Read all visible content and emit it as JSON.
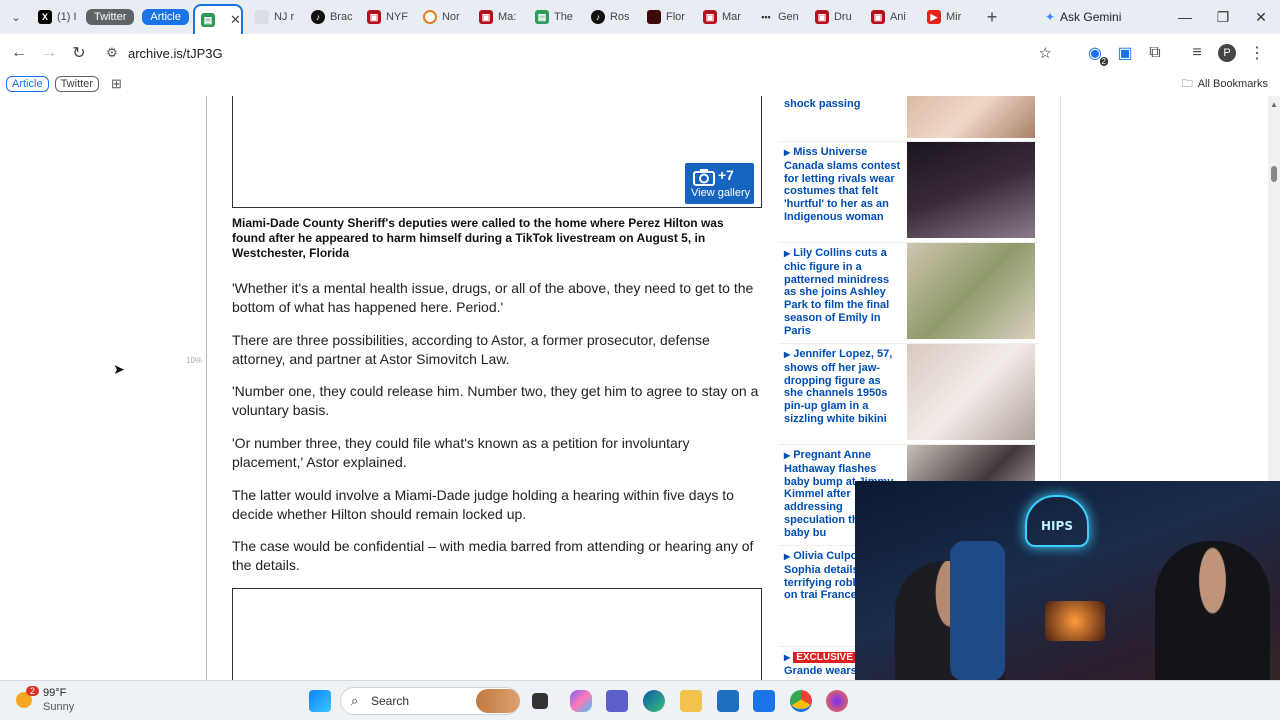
{
  "tabs": {
    "twitter_tab": "(1) I",
    "group_twitter": "Twitter",
    "group_article": "Article",
    "others": [
      "NJ r",
      "Brac",
      "NYF",
      "Nor",
      "Ma:",
      "The",
      "Ros",
      "Flor",
      "Mar",
      "Gen",
      "Dru",
      "Ani",
      "Mir"
    ],
    "ask_gemini": "Ask Gemini"
  },
  "address": {
    "url": "archive.is/tJP3G"
  },
  "bookmarks": {
    "article": "Article",
    "twitter": "Twitter",
    "all": "All Bookmarks"
  },
  "extensions": {
    "badge": "2",
    "profile": "P"
  },
  "page": {
    "scroll_pct": "10%",
    "gallery": {
      "count": "+7",
      "label": "View gallery"
    },
    "caption": "Miami-Dade County Sheriff's deputies were called to the home where Perez Hilton was found after he appeared to harm himself during a TikTok livestream on August 5, in Westchester, Florida",
    "paragraphs": [
      "'Whether it's a mental health issue, drugs, or all of the above, they need to get to the bottom of what has happened here. Period.'",
      "There are three possibilities, according to Astor, a former prosecutor, defense attorney, and partner at Astor Simovitch Law.",
      "'Number one, they could release him. Number two, they get him to agree to stay on a voluntary basis.",
      "'Or number three, they could file what's known as a petition for involuntary placement,' Astor explained.",
      "The latter would involve a Miami-Dade judge holding a hearing within five days to decide whether Hilton should remain locked up.",
      "The case would be confidential – with media barred from attending or hearing any of the details."
    ]
  },
  "sidebar": {
    "items": [
      {
        "headline": "shock passing"
      },
      {
        "headline": "Miss Universe Canada slams contest for letting rivals wear costumes that felt 'hurtful' to her as an Indigenous woman"
      },
      {
        "headline": "Lily Collins cuts a chic figure in a patterned minidress as she joins Ashley Park to film the final season of Emily In Paris"
      },
      {
        "headline": "Jennifer Lopez, 57, shows off her jaw-dropping figure as she channels 1950s pin-up glam in a sizzling white bikini"
      },
      {
        "headline": "Pregnant Anne Hathaway flashes baby bump at Jimmy Kimmel after addressing speculation th faked baby bu"
      },
      {
        "headline": "Olivia Culpo's Sophia details terrifying robb attempt on trai France: 'I was"
      },
      {
        "badge": "EXCLUSIVE",
        "headline": "Grande wears"
      }
    ]
  },
  "webcam": {
    "sign": "HIPS"
  },
  "taskbar": {
    "weather_temp": "99°F",
    "weather_cond": "Sunny",
    "weather_badge": "2",
    "search": "Search"
  }
}
